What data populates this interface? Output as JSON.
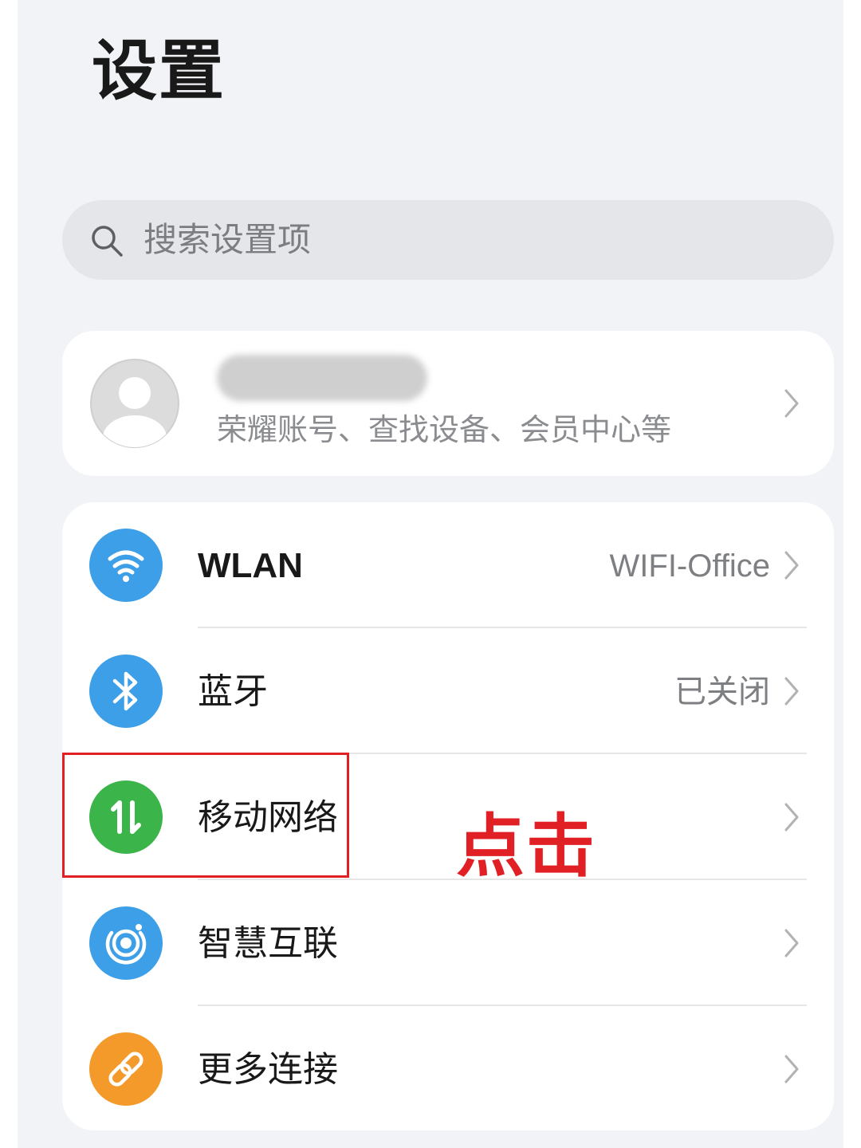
{
  "header": {
    "title": "设置"
  },
  "search": {
    "placeholder": "搜索设置项",
    "icon": "search-icon"
  },
  "account": {
    "name": "",
    "name_obscured": true,
    "subtitle": "荣耀账号、查找设备、会员中心等",
    "avatar_icon": "avatar-placeholder-icon"
  },
  "settings": {
    "items": [
      {
        "id": "wlan",
        "label": "WLAN",
        "value": "WIFI-Office",
        "icon": "wifi-icon",
        "icon_color": "#3d9fe8"
      },
      {
        "id": "bluetooth",
        "label": "蓝牙",
        "value": "已关闭",
        "icon": "bluetooth-icon",
        "icon_color": "#3d9fe8"
      },
      {
        "id": "mobile-network",
        "label": "移动网络",
        "value": "",
        "icon": "mobile-data-icon",
        "icon_color": "#3bb54a"
      },
      {
        "id": "smart-connect",
        "label": "智慧互联",
        "value": "",
        "icon": "smart-connect-icon",
        "icon_color": "#3d9fe8"
      },
      {
        "id": "more-connections",
        "label": "更多连接",
        "value": "",
        "icon": "link-icon",
        "icon_color": "#f39a2b"
      }
    ]
  },
  "annotation": {
    "text": "点击",
    "color": "#e12026",
    "highlighted_item": "移动网络"
  }
}
